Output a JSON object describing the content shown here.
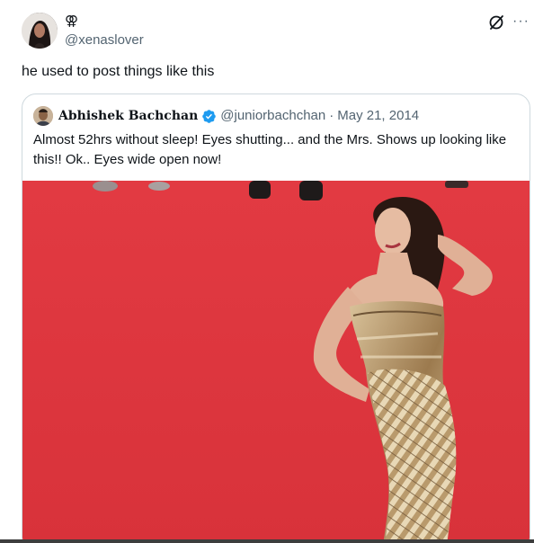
{
  "author": {
    "display_name": "⚢",
    "handle": "@xenaslover",
    "avatar_icon": "profile-photo"
  },
  "tweet": {
    "text": "he used to post things like this"
  },
  "actions": {
    "grok_icon": "grok-icon",
    "more_icon": "more-options-icon",
    "more_glyph": "···"
  },
  "quoted": {
    "display_name": "Abhishek Bachchan",
    "verified": true,
    "handle": "@juniorbachchan",
    "separator": "·",
    "date": "May 21, 2014",
    "text": "Almost 52hrs without sleep! Eyes shutting... and the Mrs. Shows up looking like this!! Ok.. Eyes wide open now!",
    "media_description_icon": "photo"
  },
  "colors": {
    "text_primary": "#0f1419",
    "text_secondary": "#536471",
    "border": "#cfd9de",
    "verified_blue": "#1d9bf0",
    "carpet_red": "#e0333d"
  }
}
